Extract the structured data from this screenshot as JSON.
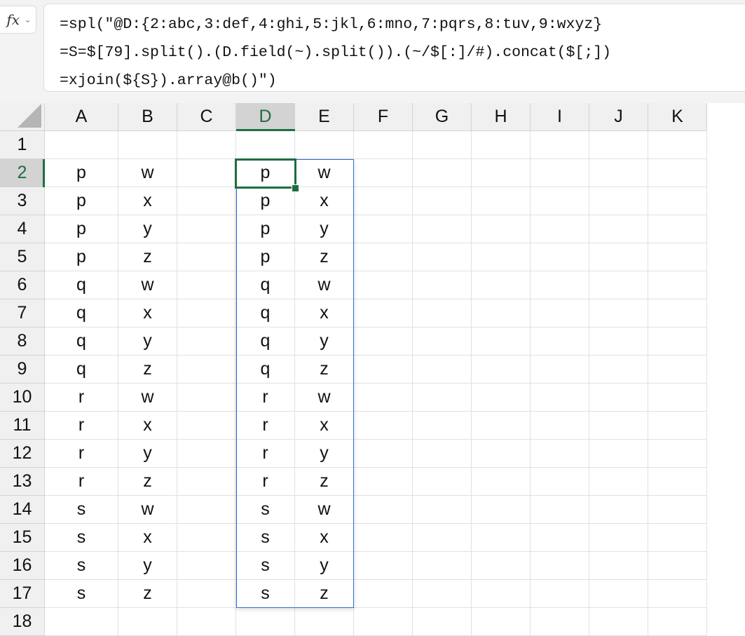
{
  "formula_bar": {
    "fx_label": "fx",
    "chevron": "⌄",
    "lines": [
      "=spl(\"@D:{2:abc,3:def,4:ghi,5:jkl,6:mno,7:pqrs,8:tuv,9:wxyz}",
      "=S=$[79].split().(D.field(~).split()).(~/$[:]/#).concat($[;])",
      "=xjoin(${S}).array@b()\")"
    ]
  },
  "sheet": {
    "columns": [
      "A",
      "B",
      "C",
      "D",
      "E",
      "F",
      "G",
      "H",
      "I",
      "J",
      "K"
    ],
    "row_numbers": [
      "1",
      "2",
      "3",
      "4",
      "5",
      "6",
      "7",
      "8",
      "9",
      "10",
      "11",
      "12",
      "13",
      "14",
      "15",
      "16",
      "17",
      "18"
    ],
    "active_cell": "D2",
    "selection_color": "#1e6e3f",
    "range_color": "#2b6fd6",
    "cells": {
      "A": [
        "",
        "p",
        "p",
        "p",
        "p",
        "q",
        "q",
        "q",
        "q",
        "r",
        "r",
        "r",
        "r",
        "s",
        "s",
        "s",
        "s",
        ""
      ],
      "B": [
        "",
        "w",
        "x",
        "y",
        "z",
        "w",
        "x",
        "y",
        "z",
        "w",
        "x",
        "y",
        "z",
        "w",
        "x",
        "y",
        "z",
        ""
      ],
      "D": [
        "",
        "p",
        "p",
        "p",
        "p",
        "q",
        "q",
        "q",
        "q",
        "r",
        "r",
        "r",
        "r",
        "s",
        "s",
        "s",
        "s",
        ""
      ],
      "E": [
        "",
        "w",
        "x",
        "y",
        "z",
        "w",
        "x",
        "y",
        "z",
        "w",
        "x",
        "y",
        "z",
        "w",
        "x",
        "y",
        "z",
        ""
      ]
    }
  }
}
